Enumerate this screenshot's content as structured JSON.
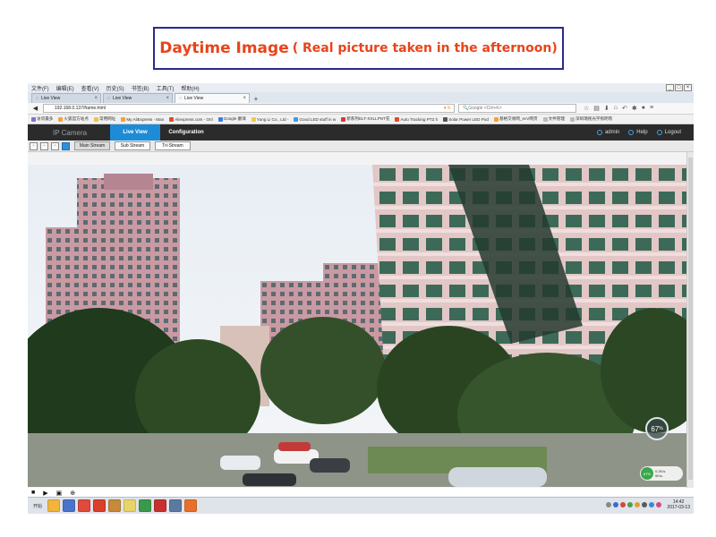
{
  "caption": {
    "title": "Daytime Image",
    "subtitle": "( Real picture taken in the afternoon)"
  },
  "browser": {
    "menu": [
      "文件(F)",
      "编辑(E)",
      "查看(V)",
      "历史(S)",
      "书签(B)",
      "工具(T)",
      "帮助(H)"
    ],
    "tabs": [
      {
        "label": "Live View",
        "active": false
      },
      {
        "label": "Live View",
        "active": false
      },
      {
        "label": "Live View",
        "active": true
      }
    ],
    "new_tab": "+",
    "url": "192.168.0.137/frame.html",
    "search_placeholder": "Google <Ctrl+K>",
    "bookmarks": [
      "访问最多",
      "火狐官方站点",
      "常用网址",
      "My AliExpress - Man",
      "Aliexpress.com - Onl",
      "Google 翻译",
      "Yung Li Co., Ltd - ",
      "Good LED stuff in w",
      "新系列ELT-XXLLPNT充",
      "Auto Tracking PTZ h",
      "Solar Power LED Pod",
      "基格交易网_ecV网页",
      "文件管理",
      "深圳瑞视光学照明有"
    ]
  },
  "app": {
    "title": "IP Camera",
    "nav": {
      "live_view": "Live View",
      "configuration": "Configuration"
    },
    "user": "admin",
    "help": "Help",
    "logout": "Logout",
    "streams": {
      "main": "Main Stream",
      "sub": "Sub Stream",
      "tri": "Tri-Stream"
    }
  },
  "overlay": {
    "gauge_value": "67",
    "gauge_unit": "%",
    "net_value": "67%",
    "upload": "0.2K/s",
    "download": "0K/s"
  },
  "taskbar": {
    "start": "开始",
    "time": "14:42",
    "date": "2017-03-13"
  }
}
